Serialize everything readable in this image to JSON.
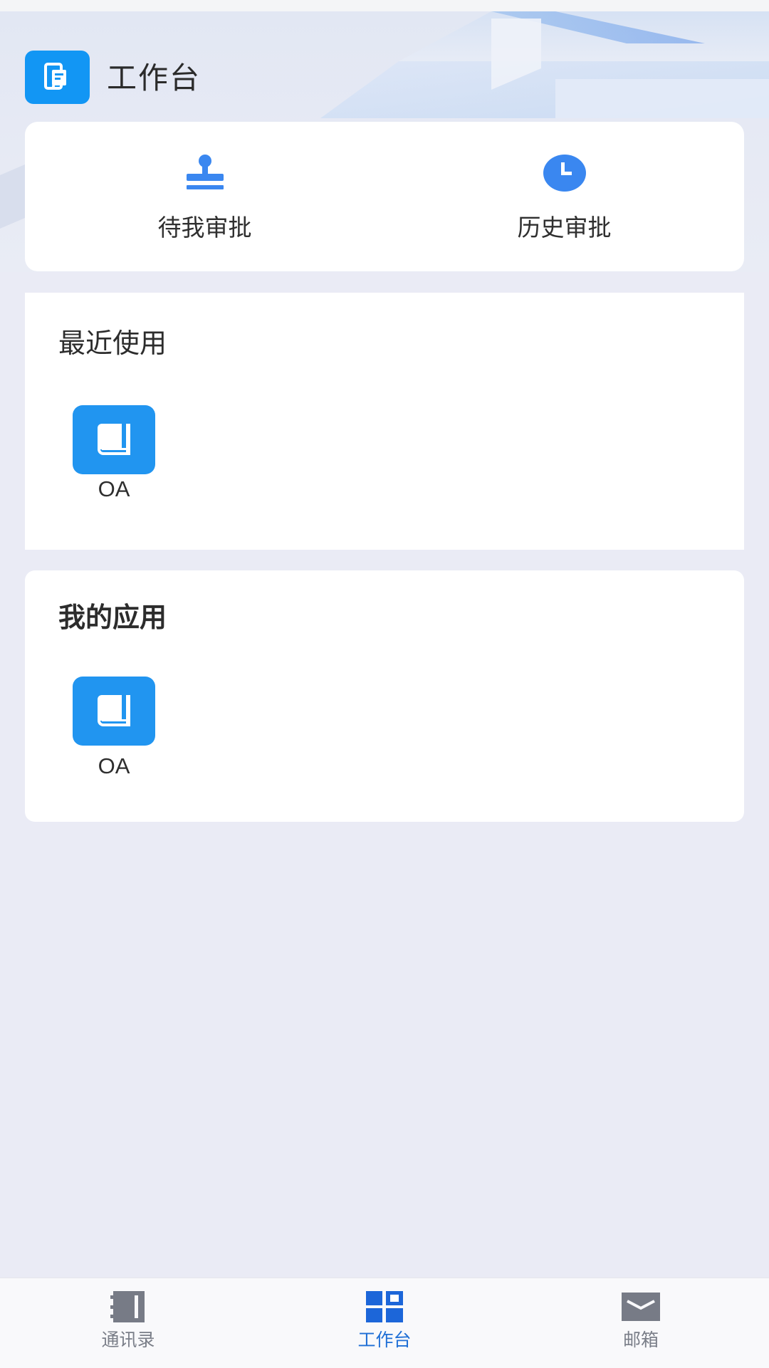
{
  "header": {
    "title": "工作台"
  },
  "approvals": {
    "items": [
      {
        "label": "待我审批",
        "icon": "stamp-icon"
      },
      {
        "label": "历史审批",
        "icon": "clock-icon"
      }
    ]
  },
  "recent": {
    "title": "最近使用",
    "apps": [
      {
        "label": "OA",
        "icon": "book-icon"
      }
    ]
  },
  "my_apps": {
    "title": "我的应用",
    "apps": [
      {
        "label": "OA",
        "icon": "book-icon"
      }
    ]
  },
  "tabbar": {
    "items": [
      {
        "label": "通讯录",
        "icon": "contacts-book-icon",
        "active": false
      },
      {
        "label": "工作台",
        "icon": "workbench-grid-icon",
        "active": true
      },
      {
        "label": "邮箱",
        "icon": "mail-icon",
        "active": false
      }
    ]
  },
  "colors": {
    "accent": "#1296F4",
    "tile": "#2195F0",
    "active_tab": "#1F6FD6",
    "inactive_tab": "#7A7E88",
    "page_bg": "#EAEBF5"
  }
}
